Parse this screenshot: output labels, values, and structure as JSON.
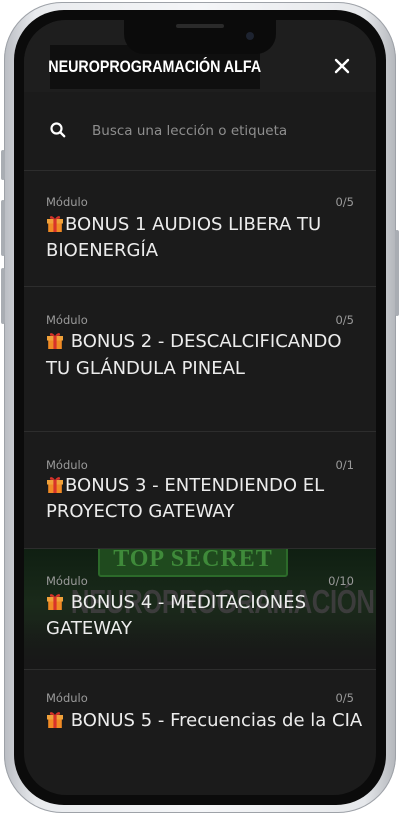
{
  "app": {
    "title": "NEUROPROGRAMACIÓN ALFA",
    "close_icon": "close-icon"
  },
  "search": {
    "placeholder": "Busca una lección o etiqueta",
    "icon": "search-icon"
  },
  "colors": {
    "background": "#1b1b1b",
    "header": "#1e1e1e",
    "divider": "#2d2d2d",
    "text": "#ececec",
    "muted": "#9a9a9a"
  },
  "modules": [
    {
      "label": "Módulo",
      "progress": "0/5",
      "icon": "gift-icon",
      "title": "BONUS 1 AUDIOS LIBERA TU BIOENERGÍA"
    },
    {
      "label": "Módulo",
      "progress": "0/5",
      "icon": "gift-icon",
      "title": " BONUS 2 - DESCALCIFICANDO TU GLÁNDULA PINEAL"
    },
    {
      "label": "Módulo",
      "progress": "0/1",
      "icon": "gift-icon",
      "title": "BONUS 3 - ENTENDIENDO EL PROYECTO GATEWAY"
    },
    {
      "label": "Módulo",
      "progress": "0/10",
      "icon": "gift-icon",
      "title": " BONUS 4 - MEDITACIONES GATEWAY",
      "banner": {
        "top_text": "TOP SECRET",
        "main_text": "NEUROPROGRAMACIÓN ALFA"
      }
    },
    {
      "label": "Módulo",
      "progress": "0/5",
      "icon": "gift-icon",
      "title": " BONUS 5 - Frecuencias de la CIA"
    }
  ]
}
